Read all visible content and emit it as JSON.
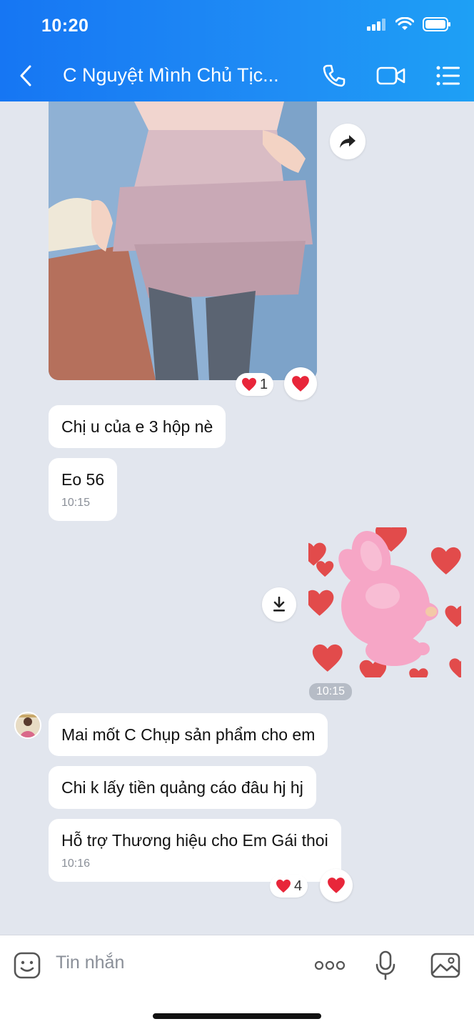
{
  "status_bar": {
    "time": "10:20"
  },
  "header": {
    "title": "C Nguyệt Mình Chủ Tịc..."
  },
  "photo_reactions": {
    "count": "1"
  },
  "messages": {
    "m1": {
      "text": "Chị u của e 3 hộp nè"
    },
    "m2": {
      "text": "Eo 56",
      "time": "10:15"
    },
    "sticker_time": "10:15",
    "m3": {
      "text": "Mai mốt C Chụp sản phẩm cho em"
    },
    "m4": {
      "text": "Chi k lấy tiền quảng cáo đâu hj hj"
    },
    "m5": {
      "text": "Hỗ trợ Thương hiệu cho Em Gái thoi",
      "time": "10:16"
    },
    "m5_reactions": {
      "count": "4"
    }
  },
  "composer": {
    "placeholder": "Tin nhắn"
  },
  "colors": {
    "header": "#1676f3",
    "chat_background": "#e2e6ee",
    "heart": "#e8263a",
    "sticker_pink": "#f6a6c6"
  },
  "icons": [
    "back-arrow-icon",
    "phone-icon",
    "video-call-icon",
    "menu-list-icon",
    "forward-icon",
    "heart-icon",
    "download-icon",
    "emoji-icon",
    "more-dots-icon",
    "microphone-icon",
    "image-icon"
  ]
}
